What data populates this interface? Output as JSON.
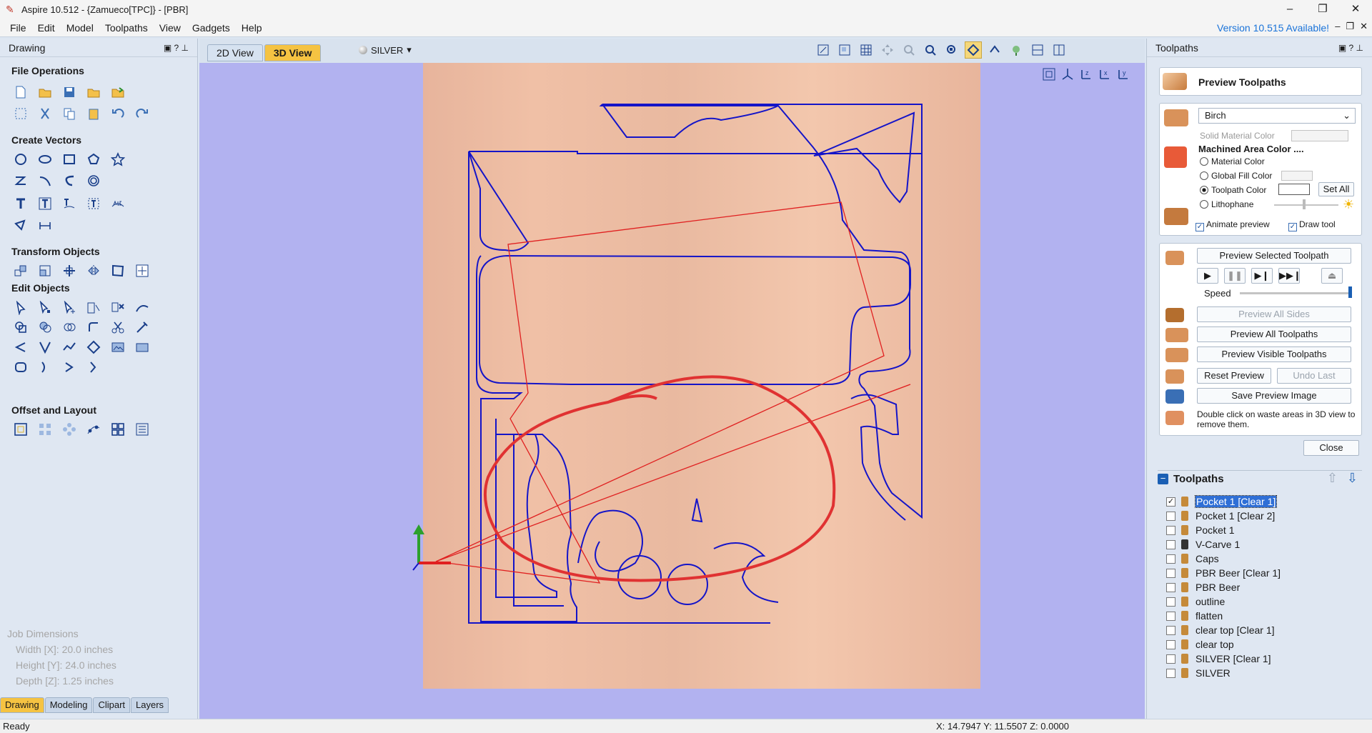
{
  "window": {
    "title": "Aspire 10.512 - {Zamueco[TPC]} - [PBR]",
    "minimize": "–",
    "maximize": "❐",
    "close": "✕"
  },
  "menu": [
    "File",
    "Edit",
    "Model",
    "Toolpaths",
    "View",
    "Gadgets",
    "Help"
  ],
  "version_notice": "Version 10.515 Available!",
  "left_panel": {
    "title": "Drawing",
    "sections": {
      "file_ops": "File Operations",
      "create_vectors": "Create Vectors",
      "transform": "Transform Objects",
      "edit_objects": "Edit Objects",
      "offset_layout": "Offset and Layout"
    },
    "job": {
      "label": "Job Dimensions",
      "width": "Width  [X]: 20.0 inches",
      "height": "Height [Y]: 24.0 inches",
      "depth": "Depth  [Z]: 1.25 inches"
    },
    "tabs": [
      "Drawing",
      "Modeling",
      "Clipart",
      "Layers"
    ]
  },
  "view": {
    "tabs": [
      "2D View",
      "3D View"
    ],
    "active_tab": "3D View",
    "material": "SILVER"
  },
  "right_panel": {
    "title": "Toolpaths",
    "preview_header": "Preview Toolpaths",
    "material": "Birch",
    "solid_material_color": "Solid Material Color",
    "machined_area_color": "Machined Area Color ....",
    "options": {
      "material_color": "Material Color",
      "global_fill_color": "Global Fill Color",
      "toolpath_color": "Toolpath Color",
      "lithophane": "Lithophane"
    },
    "set_all": "Set All",
    "animate_preview": "Animate preview",
    "draw_tool": "Draw tool",
    "preview_selected": "Preview Selected Toolpath",
    "speed": "Speed",
    "speed_level": 1.0,
    "preview_all_sides": "Preview All Sides",
    "preview_all_toolpaths": "Preview All Toolpaths",
    "preview_visible_toolpaths": "Preview Visible Toolpaths",
    "reset_preview": "Reset Preview",
    "undo_last": "Undo Last",
    "save_preview_image": "Save Preview Image",
    "hint": "Double click on waste areas in 3D view to remove them.",
    "close": "Close",
    "toolpaths_list_title": "Toolpaths",
    "toolpaths": [
      {
        "name": "Pocket 1 [Clear 1]",
        "checked": true,
        "selected": true
      },
      {
        "name": "Pocket 1 [Clear 2]",
        "checked": false
      },
      {
        "name": "Pocket 1",
        "checked": false
      },
      {
        "name": "V-Carve 1",
        "checked": false
      },
      {
        "name": "Caps",
        "checked": false
      },
      {
        "name": "PBR Beer [Clear 1]",
        "checked": false
      },
      {
        "name": "PBR Beer",
        "checked": false
      },
      {
        "name": "outline",
        "checked": false
      },
      {
        "name": "flatten",
        "checked": false
      },
      {
        "name": "clear top [Clear 1]",
        "checked": false
      },
      {
        "name": "clear top",
        "checked": false
      },
      {
        "name": "SILVER [Clear 1]",
        "checked": false
      },
      {
        "name": "SILVER",
        "checked": false
      }
    ]
  },
  "status": {
    "text": "Ready",
    "coords": "X: 14.7947 Y: 11.5507 Z: 0.0000"
  },
  "colors": {
    "accent": "#f5c342",
    "vector_blue": "#1414c8",
    "rapid_red": "#e02020",
    "canvas": "#b2b2f0",
    "version_link": "#1a73d9"
  }
}
